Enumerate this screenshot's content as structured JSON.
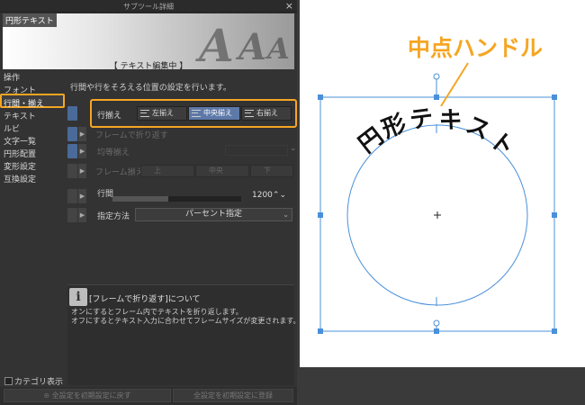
{
  "window": {
    "title": "サブツール詳細",
    "close": "×"
  },
  "preview": {
    "tag": "円形テキスト",
    "mode": "【 テキスト編集中 】",
    "letters": [
      "A",
      "A",
      "A"
    ]
  },
  "categories": [
    "操作",
    "フォント",
    "行間・揃え",
    "テキスト",
    "ルビ",
    "文字一覧",
    "円形配置",
    "変形設定",
    "互換設定"
  ],
  "selected_category": "行間・揃え",
  "description": "行間や行をそろえる位置の設定を行います。",
  "align": {
    "label": "行揃え",
    "options": [
      "左揃え",
      "中央揃え",
      "右揃え"
    ],
    "selected": "中央揃え"
  },
  "wrap_frame": {
    "label": "フレームで折り返す"
  },
  "justify": {
    "label": "均等揃え"
  },
  "frame_align": {
    "label": "フレーム揃え",
    "options": [
      "上",
      "中央",
      "下"
    ]
  },
  "line_spacing": {
    "label": "行間",
    "value": "1200",
    "spin": "⌃⌄"
  },
  "method": {
    "label": "指定方法",
    "value": "パーセント指定",
    "arrow": "⌄"
  },
  "help": {
    "icon": "i",
    "title": "[フレームで折り返す]について",
    "lines": [
      "オンにするとフレーム内でテキストを折り返します。",
      "オフにするとテキスト入力に合わせてフレームサイズが変更されます。"
    ]
  },
  "category_display": "カテゴリ表示",
  "bottom": {
    "reset": "全設定を初期設定に戻す",
    "register": "全設定を初期設定に登録"
  },
  "canvas": {
    "annotation": "中点ハンドル",
    "circle_text": [
      "円",
      "形",
      "テ",
      "キ",
      "ス",
      "ト"
    ],
    "annotation_color": "#f5a623",
    "handle_color": "#4a90d9"
  },
  "icons": [
    "close-icon",
    "info-icon",
    "eye-icon",
    "expand-triangle-icon",
    "align-left-icon",
    "align-center-icon",
    "align-right-icon",
    "spin-arrows-icon",
    "dropdown-arrow-icon",
    "checkbox-icon",
    "crosshair-icon"
  ]
}
